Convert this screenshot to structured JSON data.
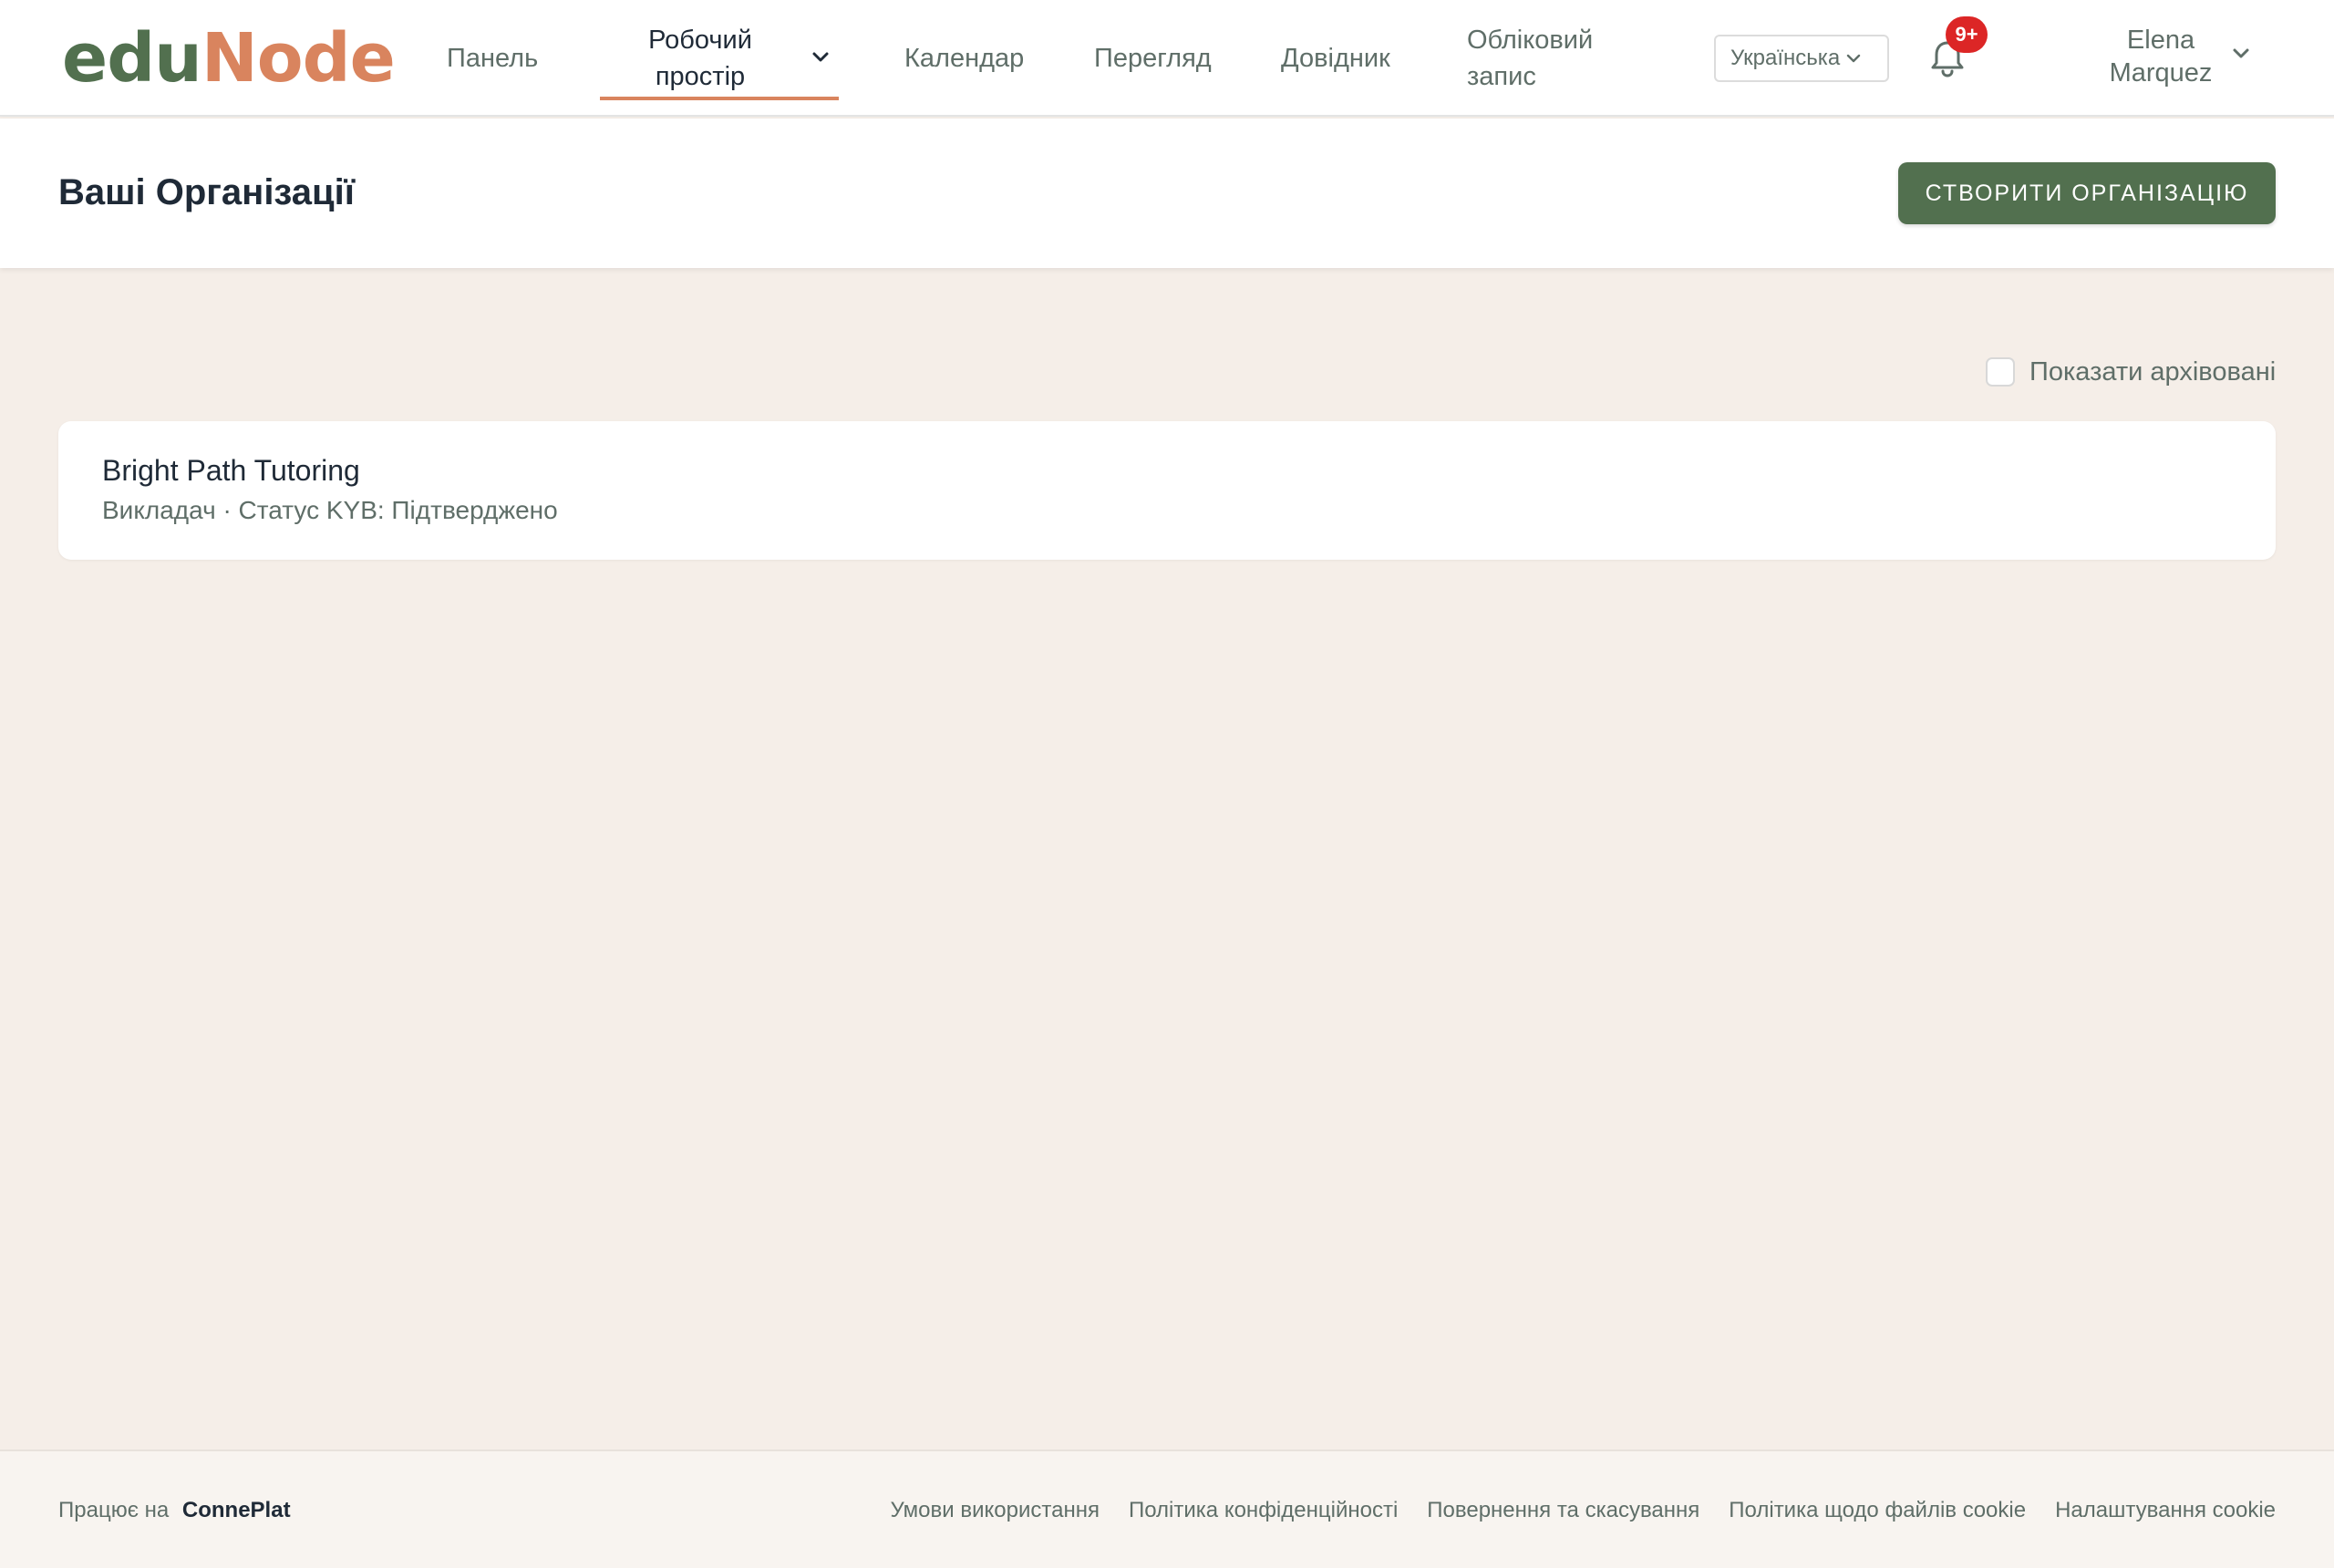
{
  "brand": {
    "logo_part1": "edu",
    "logo_part2": "Node"
  },
  "nav": {
    "dashboard": "Панель",
    "workspace_line1": "Робочий",
    "workspace_line2": "простір",
    "calendar": "Календар",
    "overview": "Перегляд",
    "reference": "Довідник",
    "account_line1": "Обліковий",
    "account_line2": "запис"
  },
  "language": {
    "selected": "Українська"
  },
  "notifications": {
    "badge": "9+"
  },
  "user": {
    "first_name": "Elena",
    "last_name": "Marquez"
  },
  "header": {
    "title": "Ваші Організації",
    "create_button": "СТВОРИТИ ОРГАНІЗАЦІЮ"
  },
  "filters": {
    "show_archived_label": "Показати архівовані",
    "show_archived_checked": false
  },
  "organizations": [
    {
      "name": "Bright Path Tutoring",
      "meta": "Викладач · Статус KYB: Підтверджено"
    }
  ],
  "footer": {
    "powered_prefix": "Працює на",
    "powered_brand": "ConnePlat",
    "links": [
      "Умови використання",
      "Політика конфіденційності",
      "Повернення та скасування",
      "Політика щодо файлів cookie",
      "Налаштування cookie"
    ]
  },
  "colors": {
    "brand_green": "#52704f",
    "brand_orange": "#d9845e",
    "background": "#f5eee8",
    "badge_red": "#dc2626"
  }
}
